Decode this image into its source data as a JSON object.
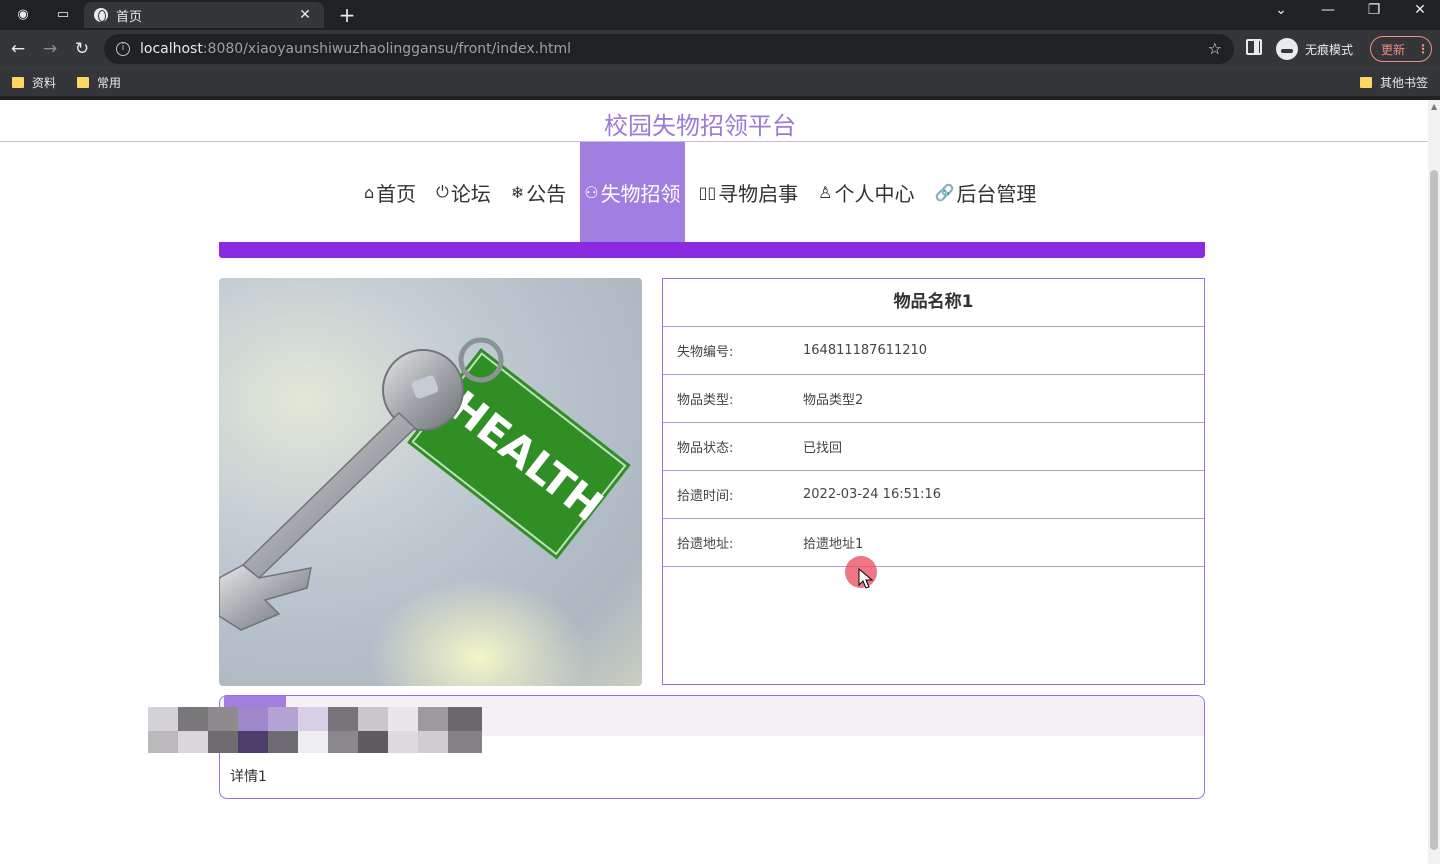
{
  "browser": {
    "tab_title": "首页",
    "url_host": "localhost",
    "url_rest": ":8080/xiaoyaunshiwuzhaolinggansu/front/index.html",
    "incognito_label": "无痕模式",
    "update_label": "更新",
    "bookmarks": [
      "资料",
      "常用"
    ],
    "other_bookmarks": "其他书签"
  },
  "site": {
    "title": "校园失物招领平台"
  },
  "menu": [
    {
      "icon": "⌂",
      "label": "首页"
    },
    {
      "icon": "⏻",
      "label": "论坛"
    },
    {
      "icon": "❄",
      "label": "公告"
    },
    {
      "icon": "⚇",
      "label": "失物招领",
      "active": true
    },
    {
      "icon": "▯▯",
      "label": "寻物启事"
    },
    {
      "icon": "♙",
      "label": "个人中心"
    },
    {
      "icon": "🔗",
      "label": "后台管理"
    }
  ],
  "item": {
    "name": "物品名称1",
    "rows": [
      {
        "label": "失物编号:",
        "value": "164811187611210"
      },
      {
        "label": "物品类型:",
        "value": "物品类型2"
      },
      {
        "label": "物品状态:",
        "value": "已找回"
      },
      {
        "label": "拾遗时间:",
        "value": "2022-03-24 16:51:16"
      },
      {
        "label": "拾遗地址:",
        "value": "拾遗地址1"
      }
    ],
    "photo_tag_text": "HEALTH",
    "detail": "详情1"
  },
  "colors": {
    "accent": "#8a2be2",
    "menu_active": "#a17fe0",
    "title": "#9b7bd6"
  }
}
